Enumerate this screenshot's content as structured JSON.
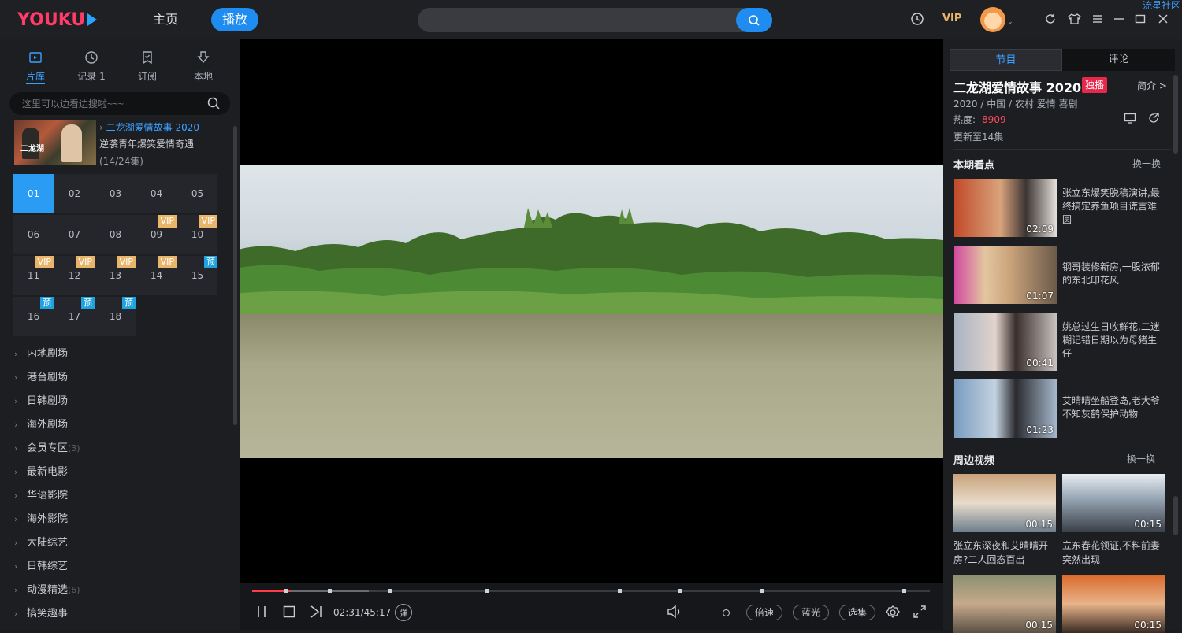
{
  "app": {
    "logo": "YOUKU",
    "nav_home": "主页",
    "nav_play": "播放",
    "vip": "VIP",
    "community": "流星社区"
  },
  "sidebar": {
    "tabs": [
      {
        "label": "片库",
        "icon": "library-icon"
      },
      {
        "label": "记录 1",
        "icon": "history-icon"
      },
      {
        "label": "订阅",
        "icon": "subscribe-icon"
      },
      {
        "label": "本地",
        "icon": "download-icon"
      }
    ],
    "search_placeholder": "这里可以边看边搜啦~~~",
    "show": {
      "title": "二龙湖爱情故事 2020",
      "subtitle": "逆袭青年爆笑爱情奇遇",
      "count": "(14/24集)",
      "thumb_text": "二龙湖"
    },
    "episodes": [
      {
        "n": "01",
        "badge": ""
      },
      {
        "n": "02",
        "badge": ""
      },
      {
        "n": "03",
        "badge": ""
      },
      {
        "n": "04",
        "badge": ""
      },
      {
        "n": "05",
        "badge": ""
      },
      {
        "n": "06",
        "badge": ""
      },
      {
        "n": "07",
        "badge": ""
      },
      {
        "n": "08",
        "badge": ""
      },
      {
        "n": "09",
        "badge": "VIP"
      },
      {
        "n": "10",
        "badge": "VIP"
      },
      {
        "n": "11",
        "badge": "VIP"
      },
      {
        "n": "12",
        "badge": "VIP"
      },
      {
        "n": "13",
        "badge": "VIP"
      },
      {
        "n": "14",
        "badge": "VIP"
      },
      {
        "n": "15",
        "badge": "预"
      },
      {
        "n": "16",
        "badge": "预"
      },
      {
        "n": "17",
        "badge": "预"
      },
      {
        "n": "18",
        "badge": "预"
      }
    ],
    "current_episode": "01",
    "categories": [
      {
        "label": "内地剧场",
        "count": ""
      },
      {
        "label": "港台剧场",
        "count": ""
      },
      {
        "label": "日韩剧场",
        "count": ""
      },
      {
        "label": "海外剧场",
        "count": ""
      },
      {
        "label": "会员专区",
        "count": "(3)"
      },
      {
        "label": "最新电影",
        "count": ""
      },
      {
        "label": "华语影院",
        "count": ""
      },
      {
        "label": "海外影院",
        "count": ""
      },
      {
        "label": "大陆综艺",
        "count": ""
      },
      {
        "label": "日韩综艺",
        "count": ""
      },
      {
        "label": "动漫精选",
        "count": "(6)"
      },
      {
        "label": "搞笑趣事",
        "count": ""
      }
    ]
  },
  "player": {
    "time": "02:31/45:17",
    "progress": 0.0557,
    "danmaku": "弹",
    "speed": "倍速",
    "quality": "蓝光",
    "select": "选集"
  },
  "right": {
    "tabs": [
      "节目",
      "评论"
    ],
    "title": "二龙湖爱情故事 2020",
    "exclusive": "独播",
    "intro": "简介 >",
    "meta": "2020 / 中国 / 农村 爱情 喜剧",
    "heat_label": "热度:",
    "heat_value": "8909",
    "update": "更新至14集",
    "highlights_title": "本期看点",
    "highlights_more": "换一换",
    "highlights": [
      {
        "duration": "02:09",
        "desc": "张立东爆笑脱稿演讲,最终搞定养鱼项目谎言难圆"
      },
      {
        "duration": "01:07",
        "desc": "钢哥装修新房,一股浓郁的东北印花风"
      },
      {
        "duration": "00:41",
        "desc": "姚总过生日收鲜花,二迷糊记错日期以为母猪生仔"
      },
      {
        "duration": "01:23",
        "desc": "艾晴晴坐船登岛,老大爷不知灰鹤保护动物"
      }
    ],
    "related_title": "周边视频",
    "related_more": "换一换",
    "related": [
      {
        "duration": "00:15",
        "desc": "张立东深夜和艾晴晴开房?二人回态百出"
      },
      {
        "duration": "00:15",
        "desc": "立东春花领证,不料前妻突然出现"
      },
      {
        "duration": "00:15",
        "desc": ""
      },
      {
        "duration": "00:15",
        "desc": ""
      }
    ]
  }
}
